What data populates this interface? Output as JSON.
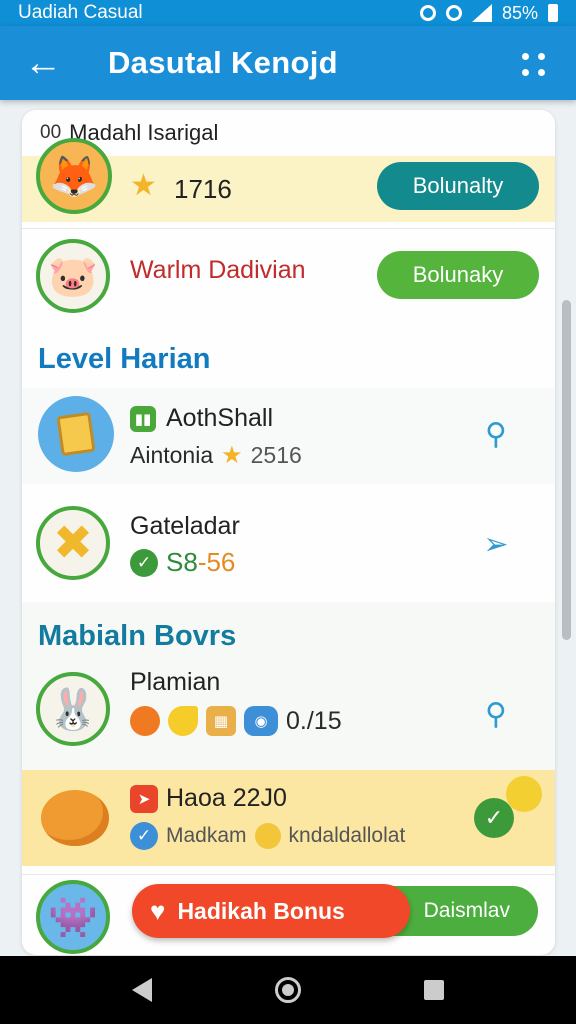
{
  "status_bar": {
    "app_name": "Uadiah Casual",
    "battery": "85%"
  },
  "header": {
    "title": "Dasutal Kenojd"
  },
  "card": {
    "heading": "Madahl Isarigal",
    "heading_icon": "00",
    "row1": {
      "value": "1716",
      "button": "Bolunalty"
    },
    "row2": {
      "title": "Warlm Dadivian",
      "button": "Bolunaky"
    },
    "section_level": "Level Harian",
    "row3": {
      "title": "AothShall",
      "sub_label": "Aintonia",
      "sub_value": "2516"
    },
    "row4": {
      "title": "Gateladar",
      "value_a": "S8",
      "value_b": "-56"
    },
    "section_bonus": "Mabialn Bovrs",
    "row5": {
      "title": "Plamian",
      "value": "0./15"
    },
    "row6": {
      "title": "Haoa 22J0",
      "sub_a": "Madkam",
      "sub_b": "kndaldallolat"
    },
    "bonus_button": "Hadikah Bonus",
    "later_button": "Daismlav"
  },
  "colors": {
    "appbar": "#1a8fd8",
    "accent_green": "#55b43c",
    "accent_teal": "#138a8e",
    "bonus_red": "#f04828"
  }
}
